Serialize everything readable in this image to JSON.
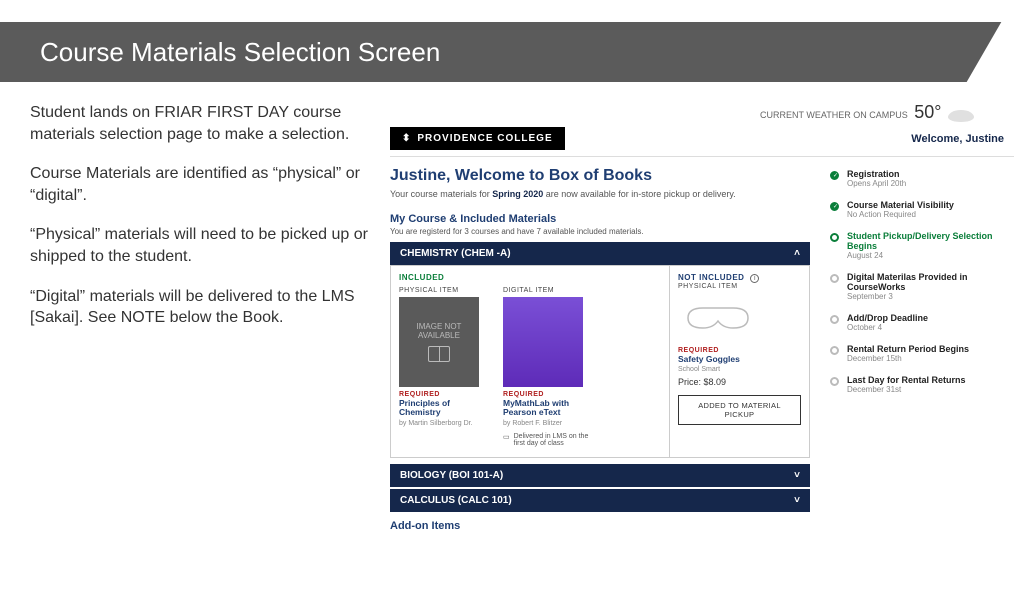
{
  "slide": {
    "title": "Course Materials Selection Screen"
  },
  "explain": {
    "p1": "Student lands on FRIAR FIRST DAY course materials selection page to make a selection.",
    "p2": "Course Materials are identified as “physical” or “digital”.",
    "p3": "“Physical” materials will need to be picked up or shipped to the student.",
    "p4": "“Digital” materials will be delivered to the LMS [Sakai]. See NOTE below the Book."
  },
  "weather": {
    "label": "CURRENT WEATHER ON CAMPUS",
    "temp": "50°"
  },
  "header": {
    "college": "PROVIDENCE COLLEGE",
    "welcome": "Welcome, Justine"
  },
  "greet": {
    "title": "Justine, Welcome to Box of Books",
    "sub_pre": "Your course materials for ",
    "term": "Spring 2020",
    "sub_post": " are now available for in-store pickup or delivery."
  },
  "section": {
    "title": "My Course & Included Materials",
    "sub": "You are registerd for 3 courses and have 7 available included materials."
  },
  "courses": [
    {
      "name": "CHEMISTRY (CHEM -A)",
      "open": true
    },
    {
      "name": "BIOLOGY (BOI 101-A)",
      "open": false
    },
    {
      "name": "CALCULUS (CALC 101)",
      "open": false
    }
  ],
  "labels": {
    "included": "INCLUDED",
    "not_included": "NOT INCLUDED",
    "physical": "PHYSICAL ITEM",
    "digital": "DIGITAL ITEM",
    "required": "REQUIRED",
    "img_na": "IMAGE NOT AVAILABLE",
    "lms_note": "Delivered in LMS on the first day of class",
    "pickup_btn": "ADDED TO MATERIAL PICKUP",
    "addon": "Add-on Items"
  },
  "items": {
    "chem_book": {
      "title": "Principles of Chemistry",
      "author": "by Martin Silberborg Dr."
    },
    "mathlab": {
      "title": "MyMathLab with Pearson eText",
      "author": "by Robert F. Blitzer"
    },
    "goggles": {
      "title": "Safety Goggles",
      "author": "School Smart",
      "price": "Price: $8.09"
    }
  },
  "timeline": [
    {
      "title": "Registration",
      "sub": "Opens April 20th",
      "state": "done"
    },
    {
      "title": "Course Material Visibility",
      "sub": "No Action Required",
      "state": "done"
    },
    {
      "title": "Student Pickup/Delivery Selection Begins",
      "sub": "August 24",
      "state": "active"
    },
    {
      "title": "Digital Materilas Provided in CourseWorks",
      "sub": "September 3",
      "state": "future"
    },
    {
      "title": "Add/Drop Deadline",
      "sub": "October 4",
      "state": "future"
    },
    {
      "title": "Rental Return Period Begins",
      "sub": "December 15th",
      "state": "future"
    },
    {
      "title": "Last Day for Rental Returns",
      "sub": "December 31st",
      "state": "future"
    }
  ]
}
